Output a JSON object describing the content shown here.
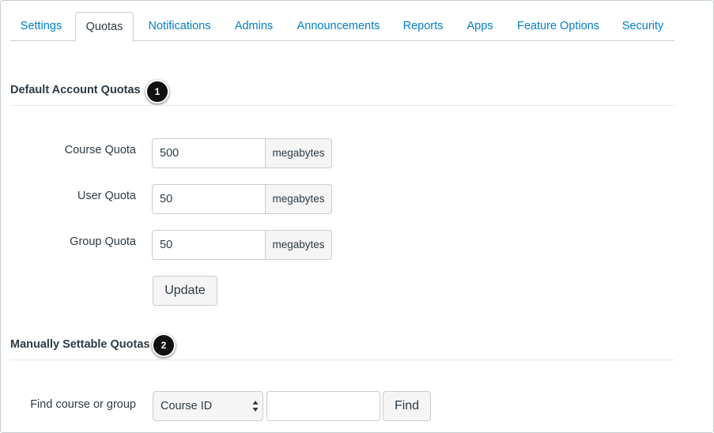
{
  "tabs": [
    {
      "label": "Settings",
      "active": false
    },
    {
      "label": "Quotas",
      "active": true
    },
    {
      "label": "Notifications",
      "active": false
    },
    {
      "label": "Admins",
      "active": false
    },
    {
      "label": "Announcements",
      "active": false
    },
    {
      "label": "Reports",
      "active": false
    },
    {
      "label": "Apps",
      "active": false
    },
    {
      "label": "Feature Options",
      "active": false
    },
    {
      "label": "Security",
      "active": false
    }
  ],
  "default_quotas": {
    "heading": "Default Account Quotas",
    "callout": "1",
    "rows": [
      {
        "label": "Course Quota",
        "value": "500",
        "unit": "megabytes"
      },
      {
        "label": "User Quota",
        "value": "50",
        "unit": "megabytes"
      },
      {
        "label": "Group Quota",
        "value": "50",
        "unit": "megabytes"
      }
    ],
    "update_label": "Update"
  },
  "manual_quotas": {
    "heading": "Manually Settable Quotas",
    "callout": "2",
    "find_label": "Find course or group",
    "select_value": "Course ID",
    "search_value": "",
    "find_button": "Find"
  },
  "colors": {
    "link": "#0081c8",
    "text": "#2d3b45",
    "border": "#c7cdd1",
    "callout_bg": "#111111"
  }
}
